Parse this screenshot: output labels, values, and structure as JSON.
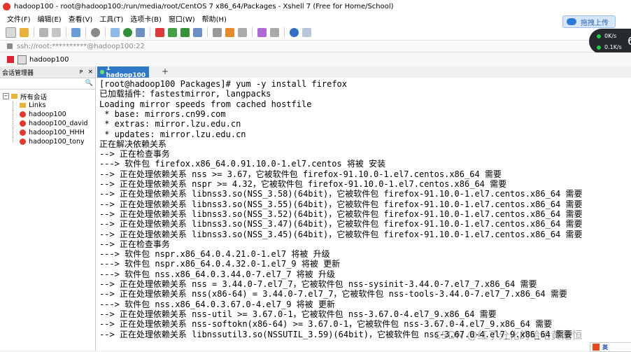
{
  "window": {
    "title": "hadoop100 - root@hadoop100:/run/media/root/CentOS 7 x86_64/Packages - Xshell 7 (Free for Home/School)"
  },
  "menu": [
    "文件(F)",
    "编辑(E)",
    "查看(V)",
    "工具(T)",
    "选项卡(B)",
    "窗口(W)",
    "帮助(H)"
  ],
  "upload_button": "拖拽上传",
  "address": "ssh://root:**********@hadoop100:22",
  "speed": {
    "up": "0K/s",
    "down": "0.1K/s",
    "badge": "6"
  },
  "quickbar": {
    "session": "hadoop100"
  },
  "sidebar": {
    "title": "会话管理器",
    "controls": [
      "ᴘ",
      "×"
    ],
    "root": "所有会话",
    "items": [
      "Links",
      "hadoop100",
      "hadoop100_david",
      "hadoop100_HHH",
      "hadoop100_tony"
    ]
  },
  "tab": {
    "label": "1 hadoop100",
    "new_tab": "+"
  },
  "terminal": {
    "lines": [
      "[root@hadoop100 Packages]# yum -y install firefox",
      "已加载插件：fastestmirror, langpacks",
      "Loading mirror speeds from cached hostfile",
      " * base: mirrors.cn99.com",
      " * extras: mirror.lzu.edu.cn",
      " * updates: mirror.lzu.edu.cn",
      "正在解决依赖关系",
      "--> 正在检查事务",
      "---> 软件包 firefox.x86_64.0.91.10.0-1.el7.centos 将被 安装",
      "--> 正在处理依赖关系 nss >= 3.67，它被软件包 firefox-91.10.0-1.el7.centos.x86_64 需要",
      "--> 正在处理依赖关系 nspr >= 4.32，它被软件包 firefox-91.10.0-1.el7.centos.x86_64 需要",
      "--> 正在处理依赖关系 libnss3.so(NSS_3.58)(64bit)，它被软件包 firefox-91.10.0-1.el7.centos.x86_64 需要",
      "--> 正在处理依赖关系 libnss3.so(NSS_3.55)(64bit)，它被软件包 firefox-91.10.0-1.el7.centos.x86_64 需要",
      "--> 正在处理依赖关系 libnss3.so(NSS_3.52)(64bit)，它被软件包 firefox-91.10.0-1.el7.centos.x86_64 需要",
      "--> 正在处理依赖关系 libnss3.so(NSS_3.47)(64bit)，它被软件包 firefox-91.10.0-1.el7.centos.x86_64 需要",
      "--> 正在处理依赖关系 libnss3.so(NSS_3.45)(64bit)，它被软件包 firefox-91.10.0-1.el7.centos.x86_64 需要",
      "--> 正在检查事务",
      "---> 软件包 nspr.x86_64.0.4.21.0-1.el7 将被 升级",
      "---> 软件包 nspr.x86_64.0.4.32.0-1.el7_9 将被 更新",
      "---> 软件包 nss.x86_64.0.3.44.0-7.el7_7 将被 升级",
      "--> 正在处理依赖关系 nss = 3.44.0-7.el7_7，它被软件包 nss-sysinit-3.44.0-7.el7_7.x86_64 需要",
      "--> 正在处理依赖关系 nss(x86-64) = 3.44.0-7.el7_7，它被软件包 nss-tools-3.44.0-7.el7_7.x86_64 需要",
      "---> 软件包 nss.x86_64.0.3.67.0-4.el7_9 将被 更新",
      "--> 正在处理依赖关系 nss-util >= 3.67.0-1，它被软件包 nss-3.67.0-4.el7_9.x86_64 需要",
      "--> 正在处理依赖关系 nss-softokn(x86-64) >= 3.67.0-1，它被软件包 nss-3.67.0-4.el7_9.x86_64 需要",
      "--> 正在处理依赖关系 libnssutil3.so(NSSUTIL_3.59)(64bit)，它被软件包 nss-3.67.0-4.el7_9.x86_64 需要"
    ]
  },
  "watermark": "CSDN @红了分化的哈哈黄浩恒",
  "ime": "英"
}
